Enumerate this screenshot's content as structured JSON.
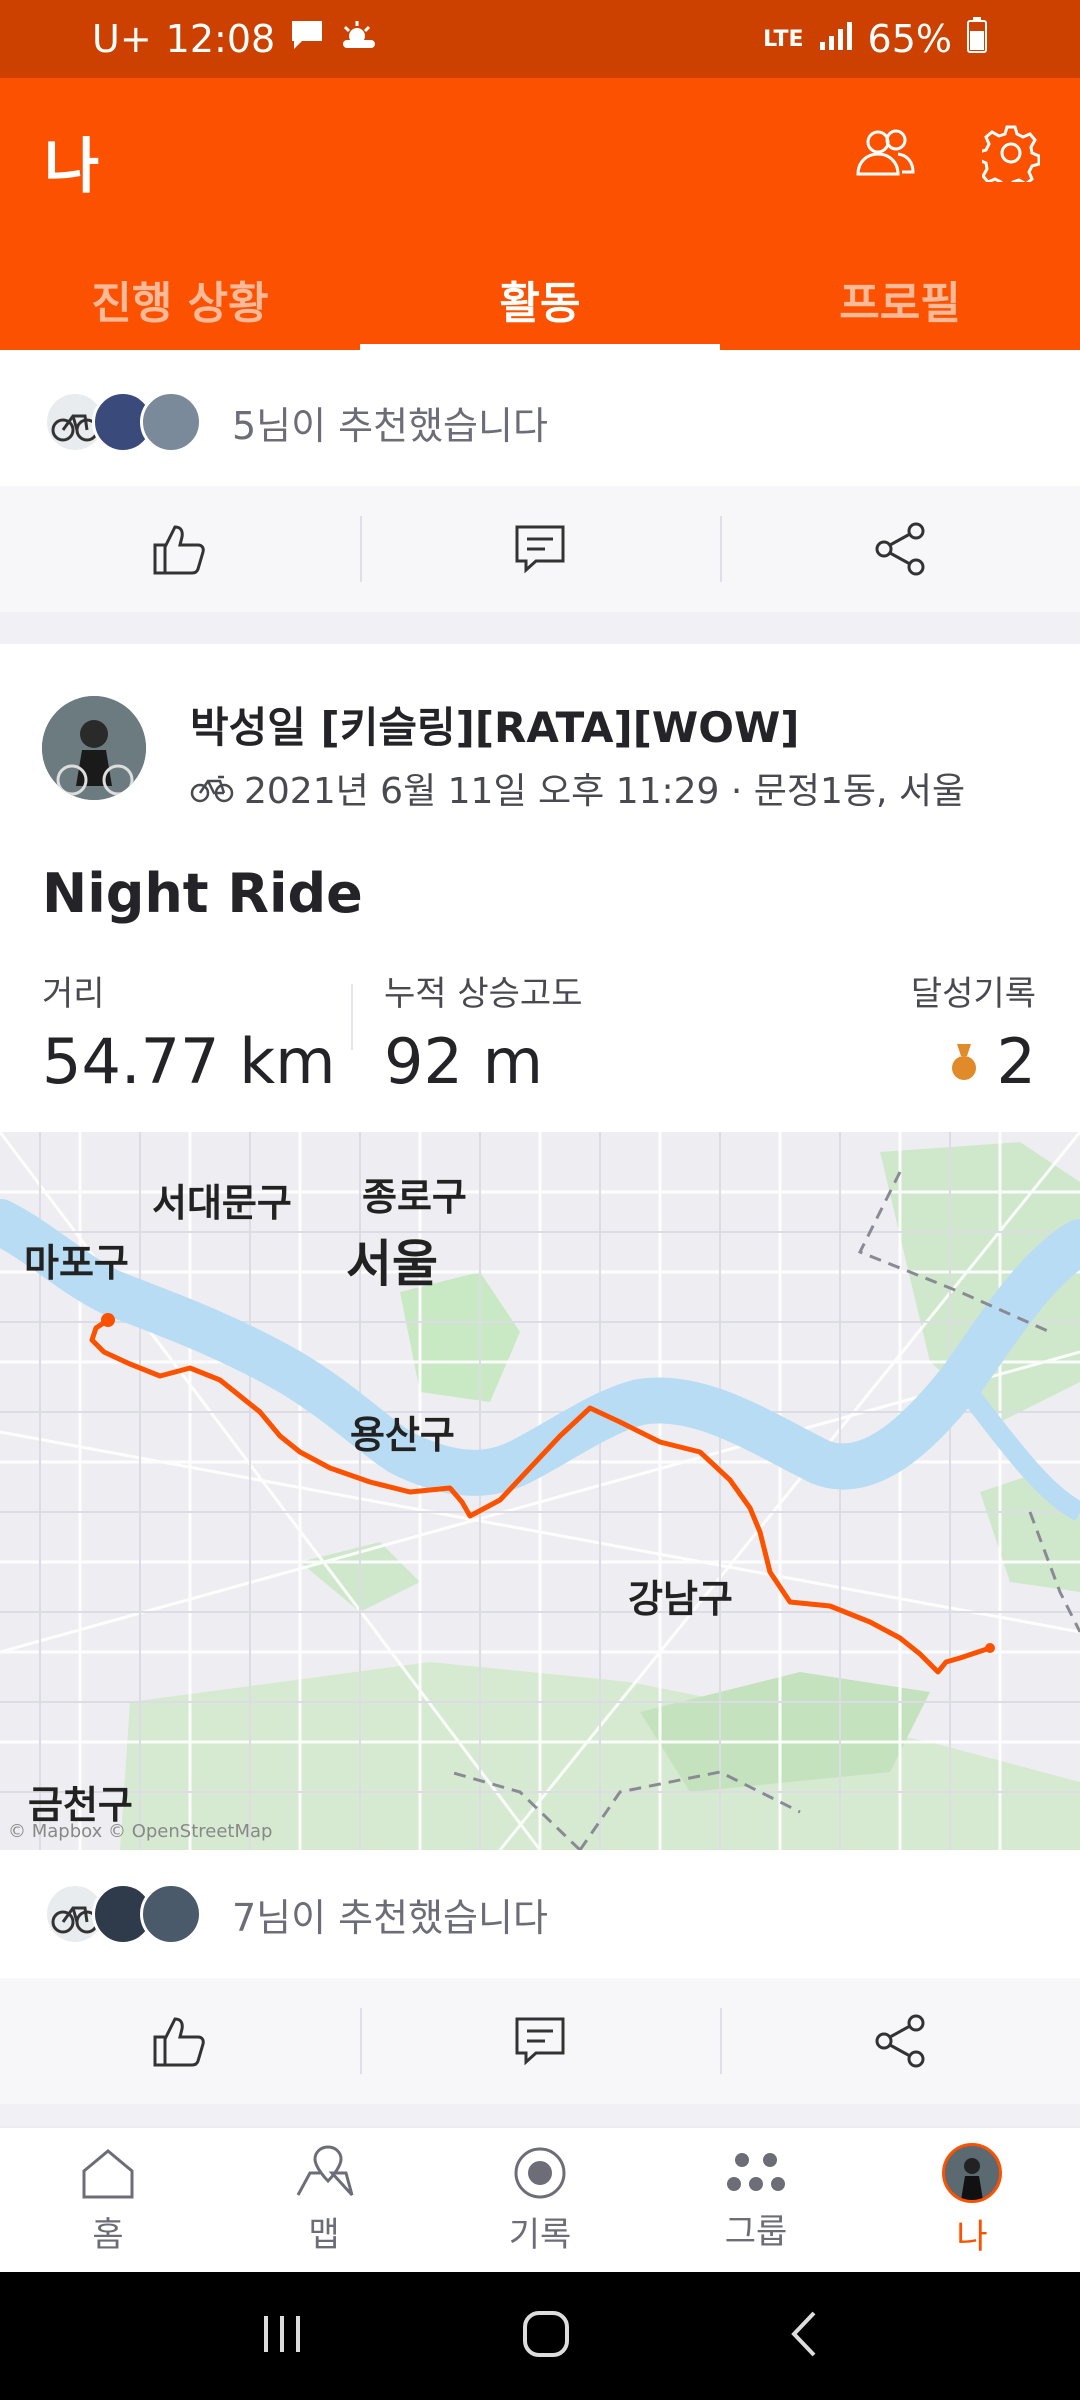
{
  "status_bar": {
    "carrier": "U+",
    "time": "12:08",
    "network": "LTE",
    "battery": "65%"
  },
  "header": {
    "title": "나",
    "tabs": [
      {
        "label": "진행 상황",
        "active": false
      },
      {
        "label": "활동",
        "active": true
      },
      {
        "label": "프로필",
        "active": false
      }
    ],
    "icons": [
      "friends-icon",
      "settings-icon"
    ]
  },
  "prev_post": {
    "kudos_text": "5님이 추천했습니다"
  },
  "activity": {
    "athlete_name": "박성일 [키슬링][RATA][WOW]",
    "meta": "2021년 6월 11일 오후 11:29 · 문정1동, 서울",
    "title": "Night Ride",
    "stats": {
      "distance_label": "거리",
      "distance_value": "54.77 km",
      "elevation_label": "누적 상승고도",
      "elevation_value": "92 m",
      "achievements_label": "달성기록",
      "achievements_value": "2"
    },
    "map": {
      "labels": {
        "seodaemun": "서대문구",
        "jongno": "종로구",
        "mapo": "마포구",
        "seoul": "서울",
        "yongsan": "용산구",
        "gangnam": "강남구",
        "geumcheon": "금천구"
      },
      "attribution": "© Mapbox © OpenStreetMap"
    },
    "kudos_text": "7님이 추천했습니다"
  },
  "bottom_nav": [
    {
      "label": "홈",
      "icon": "home-icon",
      "active": false
    },
    {
      "label": "맵",
      "icon": "map-icon",
      "active": false
    },
    {
      "label": "기록",
      "icon": "record-icon",
      "active": false
    },
    {
      "label": "그룹",
      "icon": "groups-icon",
      "active": false
    },
    {
      "label": "나",
      "icon": "avatar-icon",
      "active": true
    }
  ],
  "colors": {
    "brand": "#fc5200",
    "status_bar": "#cc4000",
    "route": "#fc5200",
    "water": "#b8dcf4",
    "park": "#c9e8c4"
  }
}
